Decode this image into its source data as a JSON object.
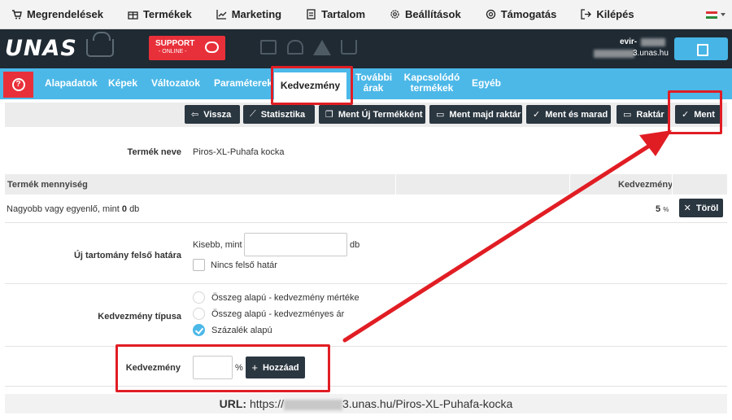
{
  "topmenu": {
    "items": [
      {
        "label": "Megrendelések",
        "icon": "cart-icon"
      },
      {
        "label": "Termékek",
        "icon": "gift-icon"
      },
      {
        "label": "Marketing",
        "icon": "chart-icon"
      },
      {
        "label": "Tartalom",
        "icon": "document-icon"
      },
      {
        "label": "Beállítások",
        "icon": "gear-icon"
      },
      {
        "label": "Támogatás",
        "icon": "lifebuoy-icon"
      },
      {
        "label": "Kilépés",
        "icon": "logout-icon"
      }
    ]
  },
  "header": {
    "logo": "UNAS",
    "support_line1": "SUPPORT",
    "support_line2": "- ONLINE -",
    "user": "evir-",
    "domain": "3.unas.hu"
  },
  "tabs": [
    {
      "label": "Alapadatok"
    },
    {
      "label": "Képek"
    },
    {
      "label": "Változatok"
    },
    {
      "label": "Paraméterek"
    },
    {
      "label": "Kedvezmény",
      "active": true
    },
    {
      "label": "További árak"
    },
    {
      "label": "Kapcsolódó termékek"
    },
    {
      "label": "Egyéb"
    }
  ],
  "toolbar": {
    "back": "Vissza",
    "stats": "Statisztika",
    "save_new": "Ment Új Termékként",
    "save_then_stock": "Ment majd raktár",
    "save_stay": "Ment és marad",
    "stock": "Raktár",
    "save": "Ment"
  },
  "product": {
    "name_label": "Termék neve",
    "name_value": "Piros-XL-Puhafa kocka"
  },
  "quantity_table": {
    "col_quantity": "Termék mennyiség",
    "col_discount": "Kedvezmény",
    "rows": [
      {
        "condition_prefix": "Nagyobb vagy egyenlő, mint",
        "amount": "0",
        "unit": "db",
        "discount": "5",
        "discount_unit": "%",
        "delete_label": "Töröl"
      }
    ]
  },
  "new_range": {
    "label": "Új tartomány felső határa",
    "less_than": "Kisebb, mint",
    "unit": "db",
    "no_upper_limit": "Nincs felső határ"
  },
  "discount_type": {
    "label": "Kedvezmény típusa",
    "options": [
      {
        "label": "Összeg alapú - kedvezmény mértéke",
        "checked": false
      },
      {
        "label": "Összeg alapú - kedvezményes ár",
        "checked": false
      },
      {
        "label": "Százalék alapú",
        "checked": true
      }
    ]
  },
  "discount_add": {
    "label": "Kedvezmény",
    "unit": "%",
    "add_label": "Hozzáad"
  },
  "url": {
    "label": "URL:",
    "prefix": "https://",
    "suffix": "3.unas.hu/Piros-XL-Puhafa-kocka"
  },
  "colors": {
    "accent_blue": "#4cb8e8",
    "dark": "#2a3640",
    "header_bg": "#1f2a33",
    "red": "#e8303a",
    "annotation_red": "#e11d24"
  }
}
